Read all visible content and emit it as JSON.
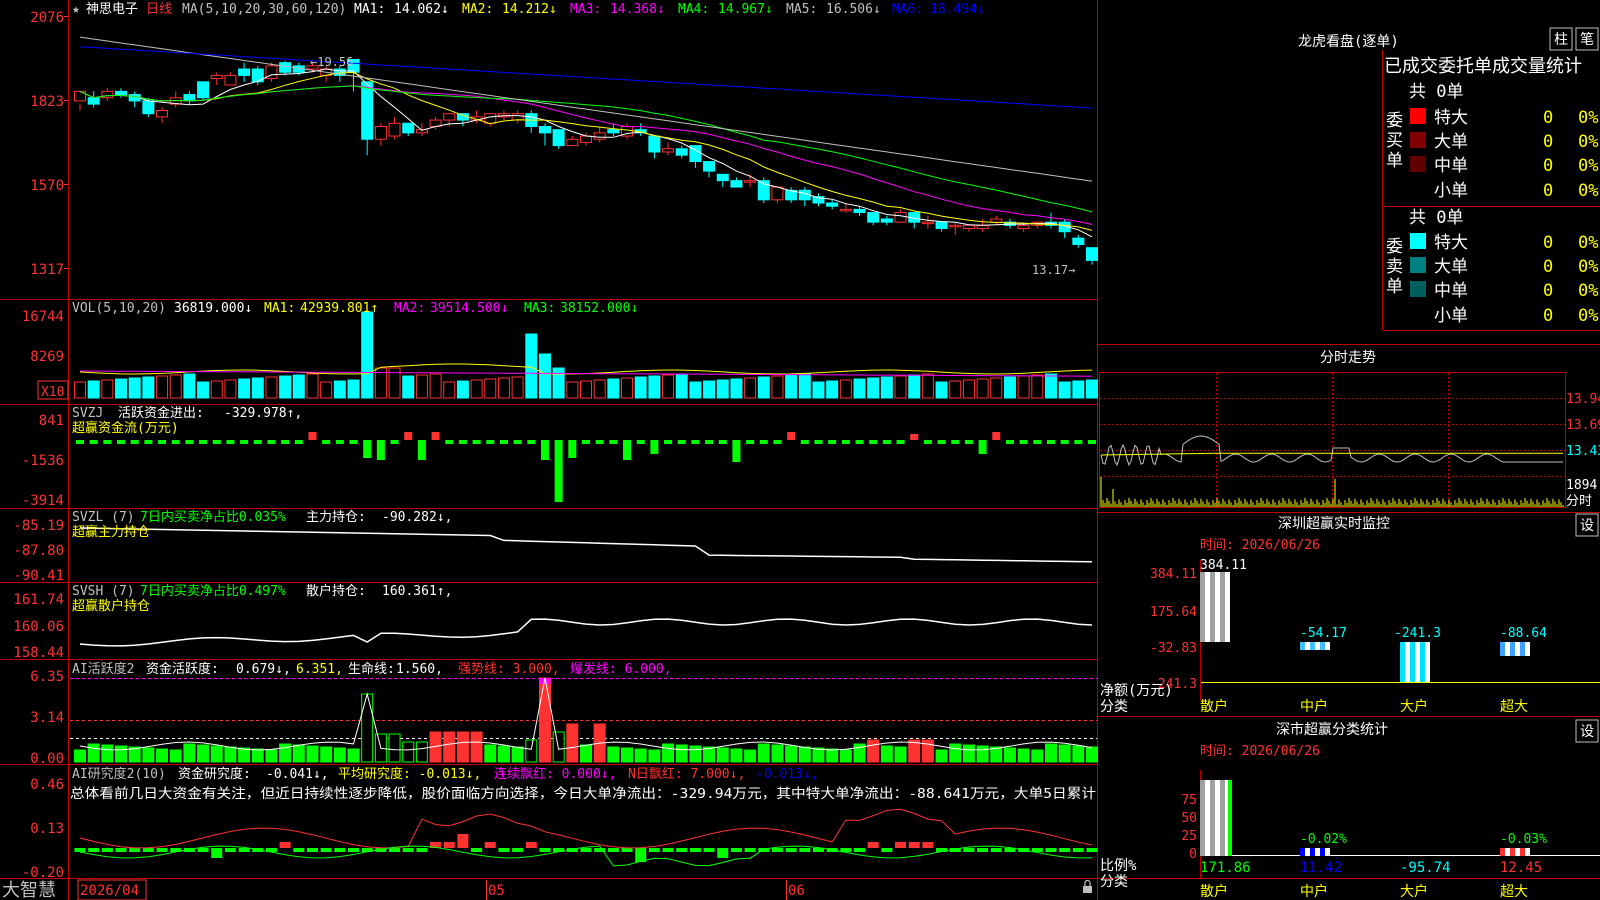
{
  "colors": {
    "up": "#ff3232",
    "down": "#00ffff",
    "ma1": "#ffffff",
    "ma2": "#ffff00",
    "ma3": "#ff00ff",
    "ma4": "#00ff00",
    "ma5": "#c0c0c0",
    "ma6": "#0000ff",
    "green": "#00ff00",
    "grid": "#c00000",
    "label": "#ff3232"
  },
  "app": {
    "brand": "大智慧",
    "lock_icon": "lock-icon"
  },
  "main": {
    "title": "神思电子",
    "period": "日线",
    "ma_params": "MA(5,10,20,30,60,120)",
    "ma": [
      {
        "label": "MA1:",
        "value": "14.062↓"
      },
      {
        "label": "MA2:",
        "value": "14.212↓"
      },
      {
        "label": "MA3:",
        "value": "14.368↓"
      },
      {
        "label": "MA4:",
        "value": "14.967↓"
      },
      {
        "label": "MA5:",
        "value": "16.506↓"
      },
      {
        "label": "MA6:",
        "value": "18.494↓"
      }
    ],
    "axis": [
      "2076",
      "1823",
      "1570",
      "1317"
    ],
    "high_mark": "←19.56",
    "low_mark": "13.17→",
    "ylim": [
      13.0,
      20.9
    ]
  },
  "vol": {
    "params": "VOL(5,10,20)",
    "value": "36819.000↓",
    "ma": [
      {
        "label": "MA1:",
        "value": "42939.801↑"
      },
      {
        "label": "MA2:",
        "value": "39514.500↓"
      },
      {
        "label": "MA3:",
        "value": "38152.000↓"
      }
    ],
    "axis": [
      "16744",
      "8269"
    ],
    "unit": "X10"
  },
  "svzj": {
    "title": "SVZJ",
    "name": "活跃资金进出:",
    "value": "-329.978↑,",
    "subtitle": "超赢资金流(万元)",
    "axis": [
      "841",
      "-1536",
      "-3914"
    ]
  },
  "svzl": {
    "title": "SVZL  (7)",
    "ratio": "7日内买卖净占比0.035%",
    "name": "主力持仓:",
    "value": "-90.282↓,",
    "subtitle": "超赢主力持仓",
    "axis": [
      "-85.19",
      "-87.80",
      "-90.41"
    ]
  },
  "svsh": {
    "title": "SVSH  (7)",
    "ratio": "7日内买卖净占比0.497%",
    "name": "散户持仓:",
    "value": "160.361↑,",
    "subtitle": "超赢散户持仓",
    "axis": [
      "161.74",
      "160.06",
      "158.44"
    ]
  },
  "ai1": {
    "title": "AI活跃度2",
    "name": "资金活跃度:",
    "value": "0.679↓,",
    "v2": "6.351,",
    "life_label": "生命线:",
    "life": "1.560,",
    "strong": "强势线:  3.000,",
    "burst": "爆发线:  6.000,",
    "axis": [
      "6.35",
      "3.14",
      "0.00"
    ]
  },
  "ai2": {
    "title": "AI研究度2(10)",
    "name": "资金研究度:",
    "value": "-0.041↓,",
    "avg": "平均研究度:  -0.013↓,",
    "red": "连续飘红:  0.000↓,",
    "nday": "N日飘红:  7.000↓,",
    "last": "-0.013↓,",
    "summary": "总体看前几日大资金有关注，但近日持续性逐步降低，股价面临方向选择，今日大单净流出：-329.94万元，其中特大单净流出：-88.641万元，大单5日累计",
    "axis": [
      "0.46",
      "0.13",
      "-0.20"
    ]
  },
  "dates": [
    "2026/04",
    "05",
    "06"
  ],
  "right": {
    "lh_title": "龙虎看盘(逐单)",
    "tab1": "柱",
    "tab2": "笔",
    "stats_header": "已成交委托单成交量统计",
    "buy": {
      "side": "委买单",
      "count": "共 0单",
      "rows": [
        {
          "name": "特大",
          "v": "0",
          "p": "0%"
        },
        {
          "name": "大单",
          "v": "0",
          "p": "0%"
        },
        {
          "name": "中单",
          "v": "0",
          "p": "0%"
        },
        {
          "name": "小单",
          "v": "0",
          "p": "0%"
        }
      ]
    },
    "sell": {
      "side": "委卖单",
      "count": "共 0单",
      "rows": [
        {
          "name": "特大",
          "v": "0",
          "p": "0%"
        },
        {
          "name": "大单",
          "v": "0",
          "p": "0%"
        },
        {
          "name": "中单",
          "v": "0",
          "p": "0%"
        },
        {
          "name": "小单",
          "v": "0",
          "p": "0%"
        }
      ]
    },
    "fs_title": "分时走势",
    "fs_axis": [
      "13.94",
      "13.69",
      "13.43"
    ],
    "fs_vol": "1894",
    "fs_unit": "分时",
    "sz_title": "深圳超赢实时监控",
    "sz_set": "设",
    "sz_time": "时间: 2026/06/26",
    "sz_axis": [
      "384.11",
      "175.64",
      "-32.83",
      "-241.3"
    ],
    "sz_values": [
      "384.11",
      "-54.17",
      "-241.3",
      "-88.64"
    ],
    "sz_y1": "净额(万元)",
    "sz_y2": "分类",
    "cats": [
      "散户",
      "中户",
      "大户",
      "超大"
    ],
    "cls_title": "深市超赢分类统计",
    "cls_set": "设",
    "cls_time": "时间: 2026/06/26",
    "cls_axis": [
      "75",
      "50",
      "25",
      "0"
    ],
    "cls_y1": "比例%",
    "cls_y2": "分类",
    "cls_top": [
      "-0.02%",
      "-0.03%"
    ],
    "cls_values": [
      "171.86",
      "11.42",
      "-95.74",
      "12.45"
    ]
  },
  "chart_data": {
    "type": "candlestick",
    "candles": [
      [
        18.3,
        18.6,
        18.2,
        18.0
      ],
      [
        18.4,
        18.2,
        18.6,
        18.1
      ],
      [
        18.4,
        18.6,
        18.7,
        18.3
      ],
      [
        18.6,
        18.5,
        18.7,
        18.4
      ],
      [
        18.5,
        18.3,
        18.6,
        18.1
      ],
      [
        18.3,
        17.9,
        18.4,
        17.8
      ],
      [
        17.8,
        18.0,
        18.1,
        17.6
      ],
      [
        18.2,
        18.4,
        18.6,
        18.1
      ],
      [
        18.5,
        18.3,
        18.6,
        18.2
      ],
      [
        18.9,
        18.4,
        18.9,
        18.3
      ],
      [
        19.0,
        19.1,
        19.2,
        18.8
      ],
      [
        18.8,
        19.1,
        19.2,
        18.8
      ],
      [
        19.3,
        19.1,
        19.5,
        18.9
      ],
      [
        19.3,
        18.9,
        19.4,
        18.8
      ],
      [
        19.0,
        19.4,
        19.5,
        18.9
      ],
      [
        19.5,
        19.2,
        19.56,
        19.1
      ],
      [
        19.4,
        19.2,
        19.5,
        19.1
      ],
      [
        19.3,
        19.4,
        19.5,
        19.2
      ],
      [
        19.1,
        19.3,
        19.4,
        18.9
      ],
      [
        19.3,
        19.1,
        19.4,
        18.9
      ],
      [
        19.6,
        19.2,
        19.6,
        18.6
      ],
      [
        18.9,
        17.1,
        18.9,
        16.6
      ],
      [
        17.1,
        17.5,
        17.6,
        16.9
      ],
      [
        17.2,
        17.6,
        17.8,
        17.1
      ],
      [
        17.6,
        17.3,
        17.6,
        17.2
      ],
      [
        17.3,
        17.4,
        17.6,
        17.2
      ],
      [
        17.5,
        17.7,
        17.8,
        17.4
      ],
      [
        17.7,
        17.9,
        17.9,
        17.5
      ],
      [
        17.9,
        17.7,
        17.9,
        17.5
      ],
      [
        17.7,
        17.8,
        18.0,
        17.6
      ],
      [
        17.6,
        17.9,
        17.9,
        17.5
      ],
      [
        17.8,
        17.9,
        18.0,
        17.7
      ],
      [
        17.7,
        17.9,
        18.0,
        17.6
      ],
      [
        17.9,
        17.5,
        18.0,
        17.3
      ],
      [
        17.5,
        17.3,
        17.6,
        16.9
      ],
      [
        17.4,
        16.9,
        17.4,
        16.8
      ],
      [
        16.9,
        17.1,
        17.2,
        16.9
      ],
      [
        17.0,
        17.2,
        17.3,
        16.9
      ],
      [
        17.1,
        17.3,
        17.5,
        17.0
      ],
      [
        17.4,
        17.3,
        17.6,
        17.2
      ],
      [
        17.2,
        17.5,
        17.6,
        17.1
      ],
      [
        17.4,
        17.3,
        17.6,
        17.2
      ],
      [
        17.2,
        16.7,
        17.2,
        16.5
      ],
      [
        16.7,
        16.8,
        17.0,
        16.6
      ],
      [
        16.8,
        16.6,
        16.9,
        16.5
      ],
      [
        16.9,
        16.4,
        16.9,
        16.2
      ],
      [
        16.4,
        16.1,
        16.4,
        15.9
      ],
      [
        16.0,
        15.8,
        16.0,
        15.6
      ],
      [
        15.8,
        15.6,
        15.9,
        15.6
      ],
      [
        15.8,
        15.8,
        16.0,
        15.6
      ],
      [
        15.8,
        15.2,
        15.9,
        15.1
      ],
      [
        15.2,
        15.6,
        15.6,
        15.1
      ],
      [
        15.5,
        15.2,
        15.6,
        15.1
      ],
      [
        15.5,
        15.2,
        15.6,
        15.0
      ],
      [
        15.3,
        15.1,
        15.4,
        15.0
      ],
      [
        15.1,
        15.0,
        15.2,
        14.9
      ],
      [
        14.9,
        14.9,
        15.1,
        14.8
      ],
      [
        14.9,
        14.8,
        15.0,
        14.7
      ],
      [
        14.8,
        14.5,
        14.8,
        14.4
      ],
      [
        14.6,
        14.5,
        14.7,
        14.4
      ],
      [
        14.5,
        14.8,
        14.9,
        14.5
      ],
      [
        14.8,
        14.5,
        14.8,
        14.3
      ],
      [
        14.5,
        14.5,
        14.7,
        14.3
      ],
      [
        14.5,
        14.3,
        14.5,
        14.2
      ],
      [
        14.4,
        14.4,
        14.5,
        14.1
      ],
      [
        14.3,
        14.4,
        14.4,
        14.2
      ],
      [
        14.3,
        14.4,
        14.6,
        14.2
      ],
      [
        14.5,
        14.6,
        14.7,
        14.4
      ],
      [
        14.5,
        14.4,
        14.6,
        14.3
      ],
      [
        14.3,
        14.4,
        14.5,
        14.2
      ],
      [
        14.4,
        14.5,
        14.5,
        14.3
      ],
      [
        14.5,
        14.4,
        14.8,
        14.3
      ],
      [
        14.5,
        14.2,
        14.6,
        14.0
      ],
      [
        14.0,
        13.8,
        14.1,
        13.7
      ],
      [
        13.7,
        13.3,
        13.7,
        13.17
      ]
    ]
  }
}
